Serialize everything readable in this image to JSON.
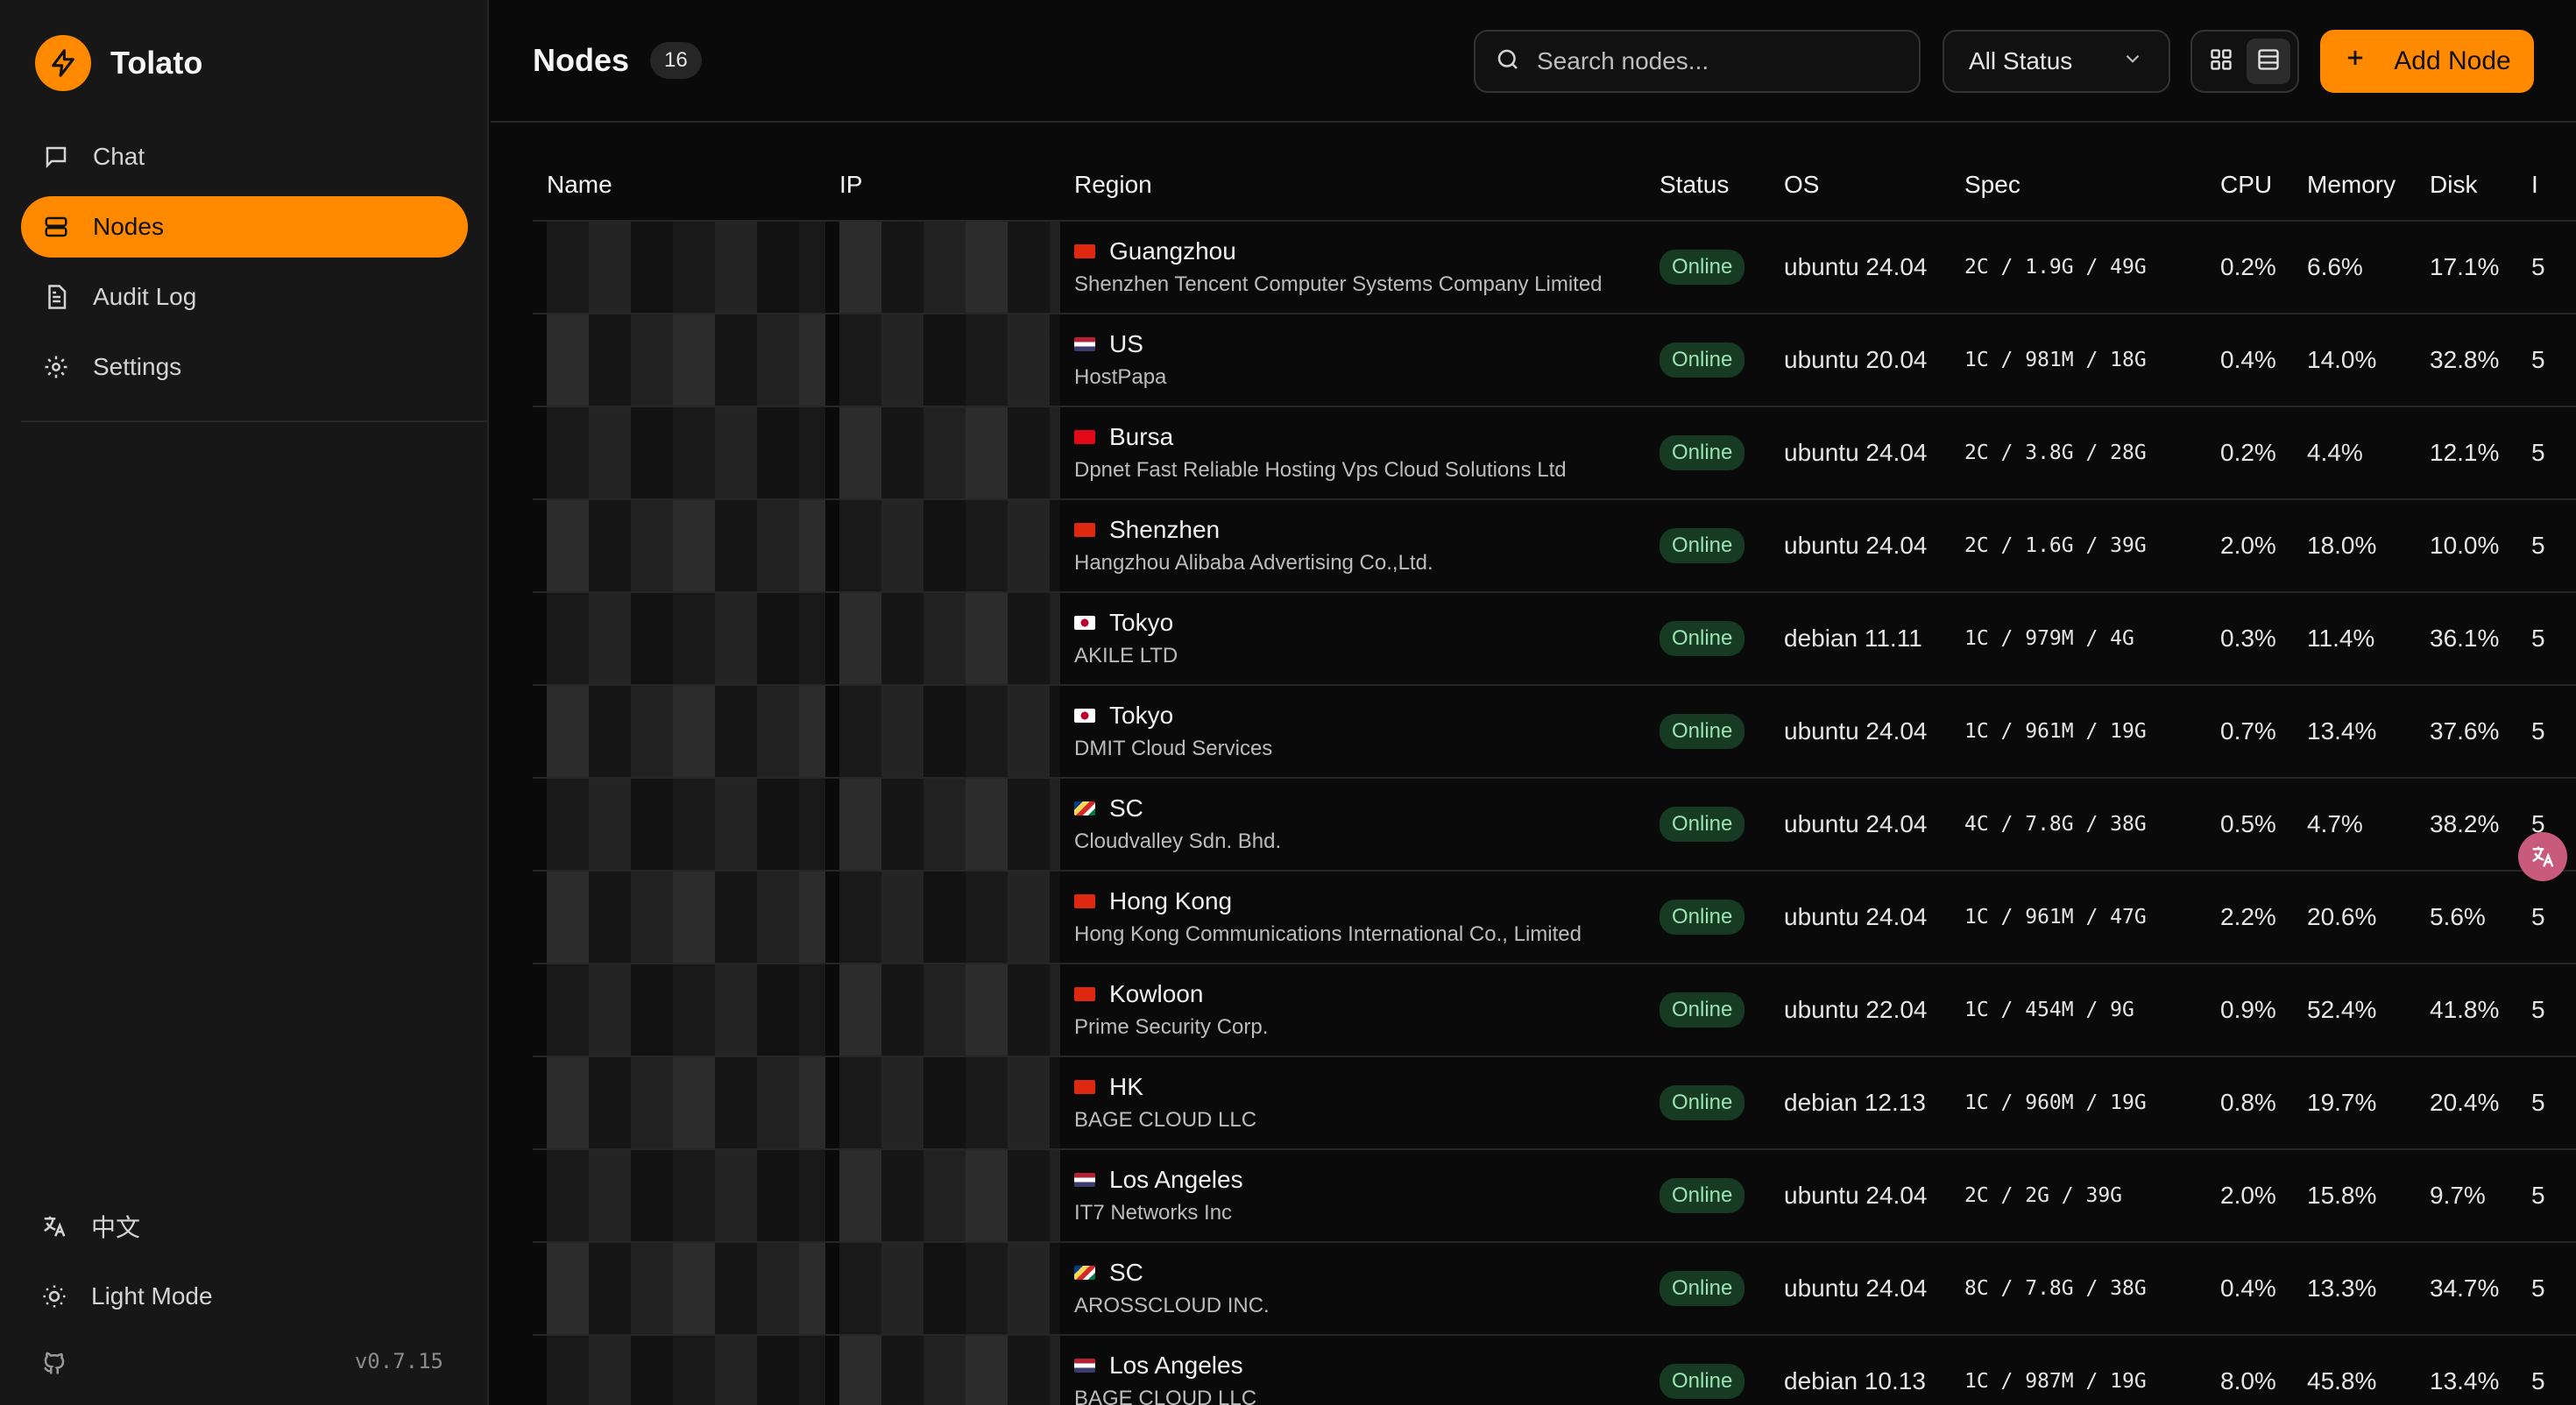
{
  "brand": {
    "name": "Tolato",
    "accent": "#ff8a00"
  },
  "sidebar": {
    "items": [
      {
        "label": "Chat",
        "icon": "chat-icon",
        "active": false
      },
      {
        "label": "Nodes",
        "icon": "server-icon",
        "active": true
      },
      {
        "label": "Audit Log",
        "icon": "document-icon",
        "active": false
      },
      {
        "label": "Settings",
        "icon": "gear-icon",
        "active": false
      }
    ],
    "language_label": "中文",
    "theme_label": "Light Mode",
    "version": "v0.7.15"
  },
  "header": {
    "title": "Nodes",
    "count": "16",
    "search_placeholder": "Search nodes...",
    "status_filter": "All Status",
    "add_label": "Add Node"
  },
  "table": {
    "columns": [
      "Name",
      "IP",
      "Region",
      "Status",
      "OS",
      "Spec",
      "CPU",
      "Memory",
      "Disk",
      "I"
    ],
    "rows": [
      {
        "city": "Guangzhou",
        "flag": "cn",
        "provider": "Shenzhen Tencent Computer Systems Company Limited",
        "status": "Online",
        "os": "ubuntu 24.04",
        "spec": "2C / 1.9G / 49G",
        "cpu": "0.2%",
        "memory": "6.6%",
        "disk": "17.1%",
        "more": "5"
      },
      {
        "city": "US",
        "flag": "us",
        "provider": "HostPapa",
        "status": "Online",
        "os": "ubuntu 20.04",
        "spec": "1C / 981M / 18G",
        "cpu": "0.4%",
        "memory": "14.0%",
        "disk": "32.8%",
        "more": "5"
      },
      {
        "city": "Bursa",
        "flag": "tr",
        "provider": "Dpnet Fast Reliable Hosting Vps Cloud Solutions Ltd",
        "status": "Online",
        "os": "ubuntu 24.04",
        "spec": "2C / 3.8G / 28G",
        "cpu": "0.2%",
        "memory": "4.4%",
        "disk": "12.1%",
        "more": "5"
      },
      {
        "city": "Shenzhen",
        "flag": "cn",
        "provider": "Hangzhou Alibaba Advertising Co.,Ltd.",
        "status": "Online",
        "os": "ubuntu 24.04",
        "spec": "2C / 1.6G / 39G",
        "cpu": "2.0%",
        "memory": "18.0%",
        "disk": "10.0%",
        "more": "5"
      },
      {
        "city": "Tokyo",
        "flag": "jp",
        "provider": "AKILE LTD",
        "status": "Online",
        "os": "debian 11.11",
        "spec": "1C / 979M / 4G",
        "cpu": "0.3%",
        "memory": "11.4%",
        "disk": "36.1%",
        "more": "5"
      },
      {
        "city": "Tokyo",
        "flag": "jp",
        "provider": "DMIT Cloud Services",
        "status": "Online",
        "os": "ubuntu 24.04",
        "spec": "1C / 961M / 19G",
        "cpu": "0.7%",
        "memory": "13.4%",
        "disk": "37.6%",
        "more": "5"
      },
      {
        "city": "SC",
        "flag": "sc",
        "provider": "Cloudvalley Sdn. Bhd.",
        "status": "Online",
        "os": "ubuntu 24.04",
        "spec": "4C / 7.8G / 38G",
        "cpu": "0.5%",
        "memory": "4.7%",
        "disk": "38.2%",
        "more": "5"
      },
      {
        "city": "Hong Kong",
        "flag": "hk",
        "provider": "Hong Kong Communications International Co., Limited",
        "status": "Online",
        "os": "ubuntu 24.04",
        "spec": "1C / 961M / 47G",
        "cpu": "2.2%",
        "memory": "20.6%",
        "disk": "5.6%",
        "more": "5"
      },
      {
        "city": "Kowloon",
        "flag": "hk",
        "provider": "Prime Security Corp.",
        "status": "Online",
        "os": "ubuntu 22.04",
        "spec": "1C / 454M / 9G",
        "cpu": "0.9%",
        "memory": "52.4%",
        "disk": "41.8%",
        "more": "5"
      },
      {
        "city": "HK",
        "flag": "hk",
        "provider": "BAGE CLOUD LLC",
        "status": "Online",
        "os": "debian 12.13",
        "spec": "1C / 960M / 19G",
        "cpu": "0.8%",
        "memory": "19.7%",
        "disk": "20.4%",
        "more": "5"
      },
      {
        "city": "Los Angeles",
        "flag": "us",
        "provider": "IT7 Networks Inc",
        "status": "Online",
        "os": "ubuntu 24.04",
        "spec": "2C / 2G / 39G",
        "cpu": "2.0%",
        "memory": "15.8%",
        "disk": "9.7%",
        "more": "5"
      },
      {
        "city": "SC",
        "flag": "sc",
        "provider": "AROSSCLOUD INC.",
        "status": "Online",
        "os": "ubuntu 24.04",
        "spec": "8C / 7.8G / 38G",
        "cpu": "0.4%",
        "memory": "13.3%",
        "disk": "34.7%",
        "more": "5"
      },
      {
        "city": "Los Angeles",
        "flag": "us",
        "provider": "BAGE CLOUD LLC",
        "status": "Online",
        "os": "debian 10.13",
        "spec": "1C / 987M / 19G",
        "cpu": "8.0%",
        "memory": "45.8%",
        "disk": "13.4%",
        "more": "5"
      }
    ]
  }
}
